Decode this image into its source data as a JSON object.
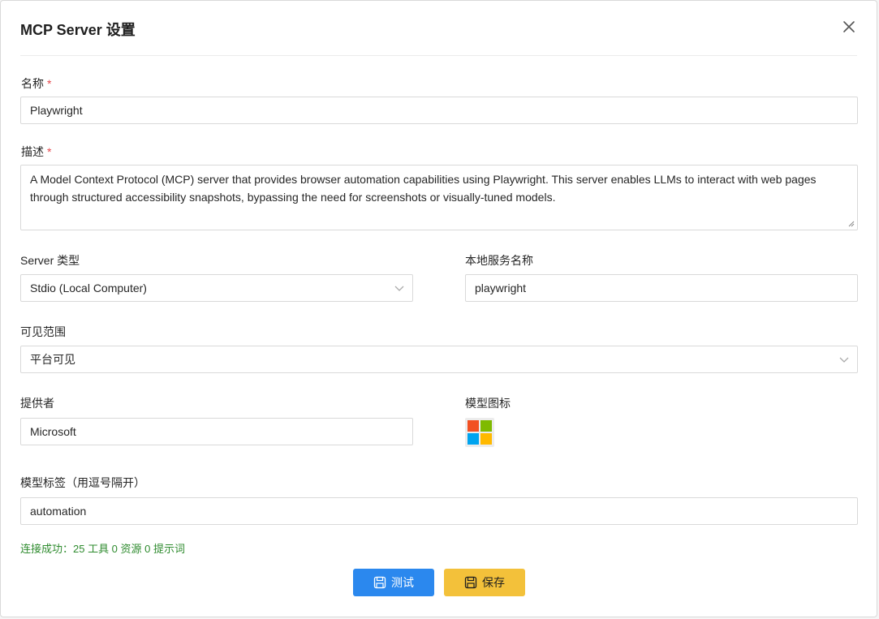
{
  "dialog": {
    "title": "MCP Server 设置"
  },
  "fields": {
    "name": {
      "label": "名称",
      "required_mark": "*",
      "value": "Playwright"
    },
    "description": {
      "label": "描述",
      "required_mark": "*",
      "value": "A Model Context Protocol (MCP) server that provides browser automation capabilities using Playwright. This server enables LLMs to interact with web pages through structured accessibility snapshots, bypassing the need for screenshots or visually-tuned models."
    },
    "server_type": {
      "label": "Server 类型",
      "value": "Stdio (Local Computer)"
    },
    "local_service_name": {
      "label": "本地服务名称",
      "value": "playwright"
    },
    "visibility": {
      "label": "可见范围",
      "value": "平台可见"
    },
    "provider": {
      "label": "提供者",
      "value": "Microsoft"
    },
    "model_icon": {
      "label": "模型图标",
      "icon": "microsoft-logo-icon",
      "colors": [
        "#f25022",
        "#7fba00",
        "#00a4ef",
        "#ffb900"
      ]
    },
    "tags": {
      "label": "模型标签（用逗号隔开）",
      "value": "automation"
    }
  },
  "status": {
    "text": "连接成功：25 工具 0 资源 0 提示词",
    "color": "#2e8b2e"
  },
  "actions": {
    "test_label": "测试",
    "save_label": "保存",
    "test_color": "#2b88ee",
    "save_color": "#f3c13a"
  }
}
